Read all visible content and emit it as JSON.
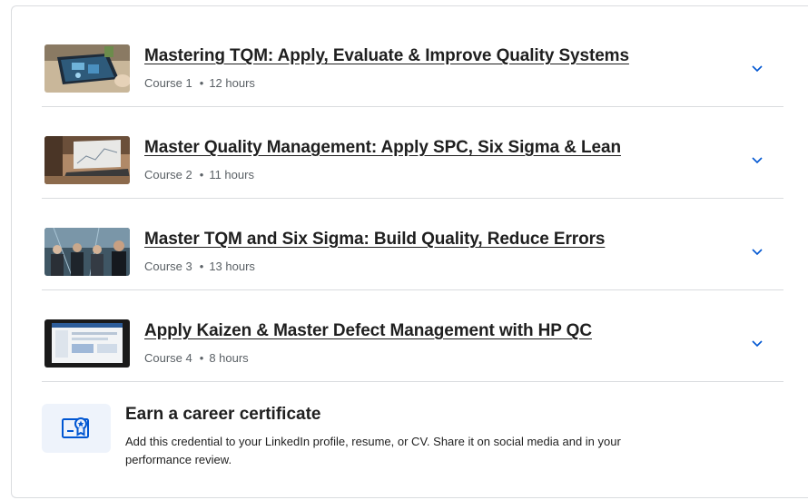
{
  "courses": [
    {
      "title": "Mastering TQM: Apply, Evaluate & Improve Quality Systems",
      "course_label": "Course 1",
      "duration": "12 hours"
    },
    {
      "title": "Master Quality Management: Apply SPC, Six Sigma & Lean",
      "course_label": "Course 2",
      "duration": "11 hours"
    },
    {
      "title": "Master TQM and Six Sigma: Build Quality, Reduce Errors",
      "course_label": "Course 3",
      "duration": "13 hours"
    },
    {
      "title": "Apply Kaizen & Master Defect Management with HP QC",
      "course_label": "Course 4",
      "duration": "8 hours"
    }
  ],
  "separator": "•",
  "certificate": {
    "title": "Earn a career certificate",
    "description": "Add this credential to your LinkedIn profile, resume, or CV. Share it on social media and in your performance review."
  },
  "icons": {
    "chevron": "chevron-down-icon",
    "certificate": "certificate-icon"
  },
  "colors": {
    "accent": "#0056d2",
    "meta_text": "#5b6166",
    "divider": "#dadcdf",
    "icon_bg": "#eef3fb"
  }
}
